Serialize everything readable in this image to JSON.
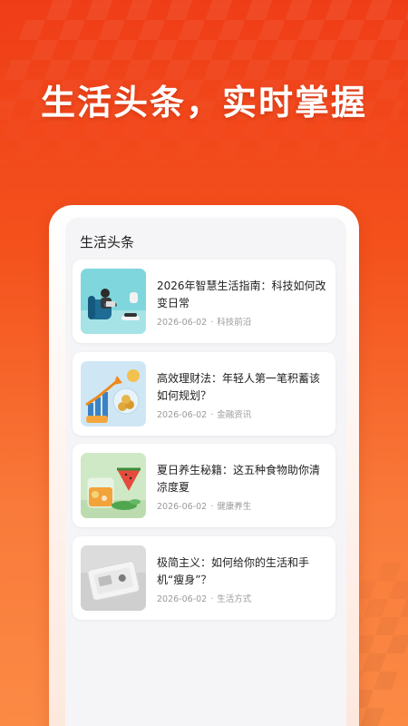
{
  "headline": "生活头条，实时掌握",
  "section": {
    "title": "生活头条"
  },
  "articles": [
    {
      "title": "2026年智慧生活指南：科技如何改变日常",
      "date": "2026-06-02",
      "category": "科技前沿",
      "thumb_icon": "smart-home-thumbnail"
    },
    {
      "title": "高效理财法：年轻人第一笔积蓄该如何规划？",
      "date": "2026-06-02",
      "category": "金融资讯",
      "thumb_icon": "finance-thumbnail"
    },
    {
      "title": "夏日养生秘籍：这五种食物助你清凉度夏",
      "date": "2026-06-02",
      "category": "健康养生",
      "thumb_icon": "summer-food-thumbnail"
    },
    {
      "title": "极简主义：如何给你的生活和手机“瘦身”？",
      "date": "2026-06-02",
      "category": "生活方式",
      "thumb_icon": "minimal-tray-thumbnail"
    }
  ],
  "meta_separator": "·",
  "colors": {
    "brand": "#f4521d",
    "card_bg": "#ffffff",
    "meta": "#9a9a9a"
  }
}
